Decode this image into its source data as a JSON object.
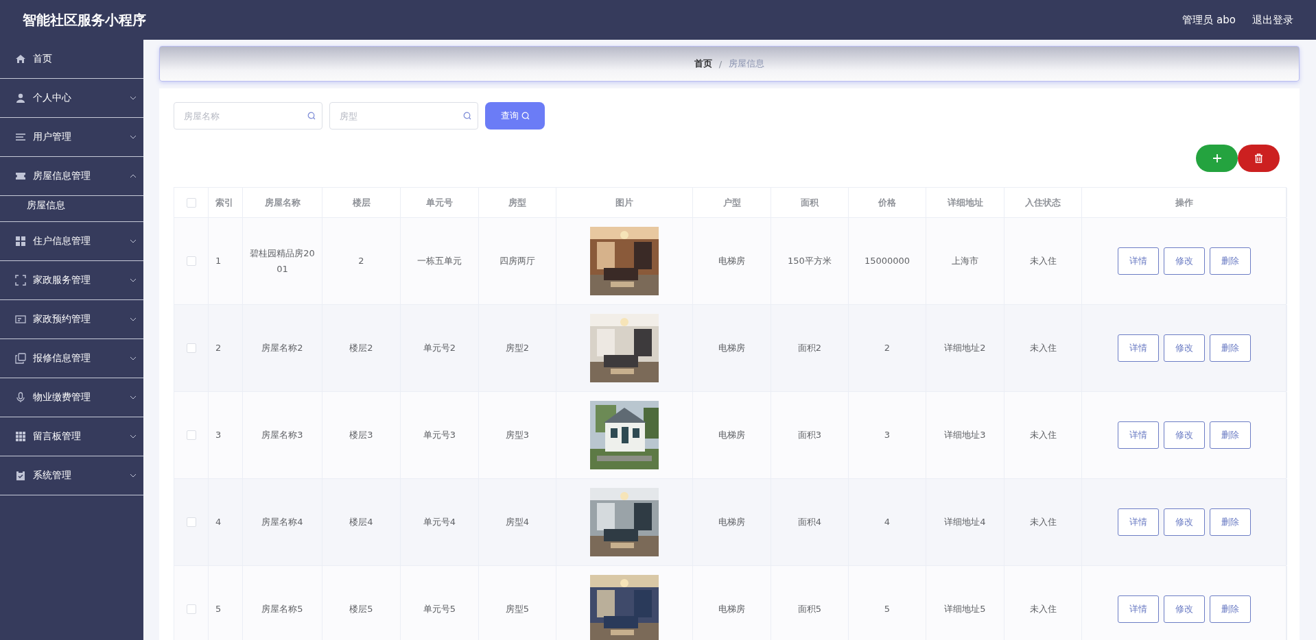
{
  "header": {
    "title": "智能社区服务小程序",
    "user": "管理员 abo",
    "logout": "退出登录"
  },
  "sidebar": {
    "items": [
      {
        "label": "首页"
      },
      {
        "label": "个人中心",
        "expanded": false
      },
      {
        "label": "用户管理",
        "expanded": false
      },
      {
        "label": "房屋信息管理",
        "expanded": true,
        "children": [
          {
            "label": "房屋信息"
          }
        ]
      },
      {
        "label": "住户信息管理",
        "expanded": false
      },
      {
        "label": "家政服务管理",
        "expanded": false
      },
      {
        "label": "家政预约管理",
        "expanded": false
      },
      {
        "label": "报修信息管理",
        "expanded": false
      },
      {
        "label": "物业缴费管理",
        "expanded": false
      },
      {
        "label": "留言板管理",
        "expanded": false
      },
      {
        "label": "系统管理",
        "expanded": false
      }
    ]
  },
  "breadcrumb": {
    "separator": "/",
    "items": [
      "首页",
      "房屋信息"
    ]
  },
  "search": {
    "fields": [
      {
        "placeholder": "房屋名称"
      },
      {
        "placeholder": "房型"
      }
    ],
    "button": "查询"
  },
  "table": {
    "header_checked": false,
    "columns": [
      "索引",
      "房屋名称",
      "楼层",
      "单元号",
      "房型",
      "图片",
      "户型",
      "面积",
      "价格",
      "详细地址",
      "入住状态",
      "操作"
    ],
    "rows": [
      {
        "checked": false,
        "cells": [
          "1",
          "碧桂园精品房2001",
          "2",
          "一栋五单元",
          "四房两厅",
          null,
          "电梯房",
          "150平方米",
          "15000000",
          "上海市",
          "未入住"
        ],
        "actions": [
          "详情",
          "修改",
          "删除"
        ]
      },
      {
        "checked": false,
        "cells": [
          "2",
          "房屋名称2",
          "楼层2",
          "单元号2",
          "房型2",
          null,
          "电梯房",
          "面积2",
          "2",
          "详细地址2",
          "未入住"
        ],
        "actions": [
          "详情",
          "修改",
          "删除"
        ]
      },
      {
        "checked": false,
        "cells": [
          "3",
          "房屋名称3",
          "楼层3",
          "单元号3",
          "房型3",
          null,
          "电梯房",
          "面积3",
          "3",
          "详细地址3",
          "未入住"
        ],
        "actions": [
          "详情",
          "修改",
          "删除"
        ]
      },
      {
        "checked": false,
        "cells": [
          "4",
          "房屋名称4",
          "楼层4",
          "单元号4",
          "房型4",
          null,
          "电梯房",
          "面积4",
          "4",
          "详细地址4",
          "未入住"
        ],
        "actions": [
          "详情",
          "修改",
          "删除"
        ]
      },
      {
        "checked": false,
        "cells": [
          "5",
          "房屋名称5",
          "楼层5",
          "单元号5",
          "房型5",
          null,
          "电梯房",
          "面积5",
          "5",
          "详细地址5",
          "未入住"
        ],
        "actions": [
          "详情",
          "修改",
          "删除"
        ]
      }
    ]
  }
}
